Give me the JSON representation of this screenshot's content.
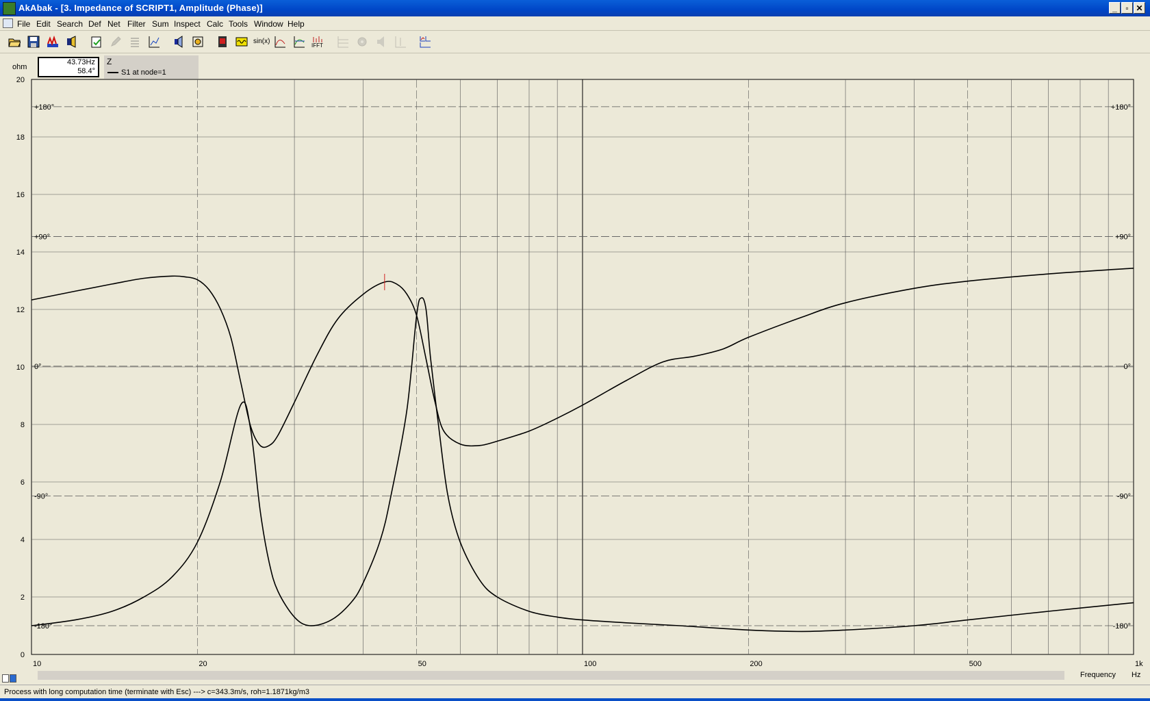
{
  "window": {
    "title": "AkAbak - [3. Impedance of SCRIPT1, Amplitude (Phase)]",
    "controls": [
      "_",
      "▫",
      "✕"
    ]
  },
  "menu": [
    {
      "label": "File"
    },
    {
      "label": "Edit"
    },
    {
      "label": "Search"
    },
    {
      "label": "Def"
    },
    {
      "label": "Net"
    },
    {
      "label": "Filter"
    },
    {
      "label": "Sum"
    },
    {
      "label": "Inspect"
    },
    {
      "label": "Calc"
    },
    {
      "label": "Tools"
    },
    {
      "label": "Window"
    },
    {
      "label": "Help"
    }
  ],
  "toolbar": {
    "buttons": [
      {
        "icon": "open-folder-icon"
      },
      {
        "icon": "save-disk-icon"
      },
      {
        "icon": "network-icon"
      },
      {
        "icon": "speaker-driver-icon"
      },
      {
        "icon": "clipboard-check-icon"
      },
      {
        "icon": "pen-icon"
      },
      {
        "icon": "list-icon"
      },
      {
        "icon": "axis-scale-icon"
      },
      {
        "icon": "speaker-left-icon"
      },
      {
        "icon": "target-icon"
      },
      {
        "icon": "stop-icon"
      },
      {
        "icon": "waveform-icon"
      },
      {
        "icon": "sine-icon",
        "label": "sin(x)"
      },
      {
        "icon": "peak-graph-icon"
      },
      {
        "icon": "dual-graph-icon"
      },
      {
        "icon": "ifft-icon",
        "label": "IFFT"
      },
      {
        "icon": "grid-disabled-icon"
      },
      {
        "icon": "gear-disabled-icon"
      },
      {
        "icon": "speaker-disabled-icon"
      },
      {
        "icon": "plot-disabled-icon"
      },
      {
        "icon": "chart-layout-icon"
      }
    ]
  },
  "readout": {
    "freq": "43.73Hz",
    "value": "58.4°"
  },
  "legend": {
    "title": "Z",
    "series_label": "S1 at node=1"
  },
  "axis": {
    "y_unit": "ohm",
    "x_caption": "Frequency",
    "x_unit": "Hz",
    "y_ticks": [
      "20",
      "18",
      "16",
      "14",
      "12",
      "10",
      "8",
      "6",
      "4",
      "2",
      "0"
    ],
    "phase_ticks": [
      "+180°",
      "+90°",
      "0°",
      "-90°",
      "-180°"
    ],
    "x_ticks": [
      "10",
      "20",
      "50",
      "100",
      "200",
      "500",
      "1k"
    ]
  },
  "chart_data": {
    "type": "line",
    "x_scale": "log",
    "xlim": [
      10,
      1000
    ],
    "ylim": [
      0,
      20
    ],
    "y2lim": [
      -180,
      180
    ],
    "cursor": {
      "x": 43.73,
      "y2": 58.4
    },
    "series": [
      {
        "axis": "ohm",
        "x": [
          10,
          12,
          14,
          16,
          18,
          20,
          22,
          24,
          25,
          26,
          27,
          28,
          30,
          32,
          35,
          38,
          40,
          43,
          45,
          48,
          50,
          51,
          52,
          53,
          55,
          57,
          60,
          65,
          70,
          80,
          90,
          100,
          120,
          150,
          200,
          250,
          300,
          400,
          500,
          700,
          1000
        ],
        "y": [
          1.0,
          1.2,
          1.5,
          2.0,
          2.7,
          3.9,
          6.0,
          8.7,
          7.8,
          5.0,
          3.2,
          2.2,
          1.3,
          1.0,
          1.2,
          1.8,
          2.5,
          4.0,
          5.6,
          8.5,
          11.8,
          12.4,
          12.0,
          10.3,
          7.7,
          5.5,
          3.9,
          2.6,
          2.0,
          1.5,
          1.3,
          1.2,
          1.1,
          1.0,
          0.85,
          0.8,
          0.85,
          1.0,
          1.2,
          1.5,
          1.8
        ]
      },
      {
        "axis": "phase",
        "x": [
          10,
          12,
          14,
          16,
          18,
          19,
          20,
          21,
          22,
          23,
          24,
          25,
          26,
          27,
          28,
          30,
          33,
          36,
          40,
          43.73,
          46,
          48,
          50,
          52,
          54,
          56,
          60,
          65,
          70,
          80,
          90,
          100,
          120,
          140,
          160,
          180,
          200,
          250,
          300,
          400,
          500,
          700,
          1000
        ],
        "y": [
          46,
          52,
          57,
          61,
          62.5,
          62,
          60,
          53,
          40,
          20,
          -12,
          -42,
          -55,
          -55,
          -48,
          -25,
          8,
          33,
          50,
          58.4,
          57,
          50,
          35,
          5,
          -25,
          -45,
          -54,
          -55,
          -52,
          -45,
          -36,
          -27,
          -10,
          3,
          7,
          12,
          20,
          34,
          44,
          54,
          59,
          64,
          68
        ]
      }
    ]
  }
}
